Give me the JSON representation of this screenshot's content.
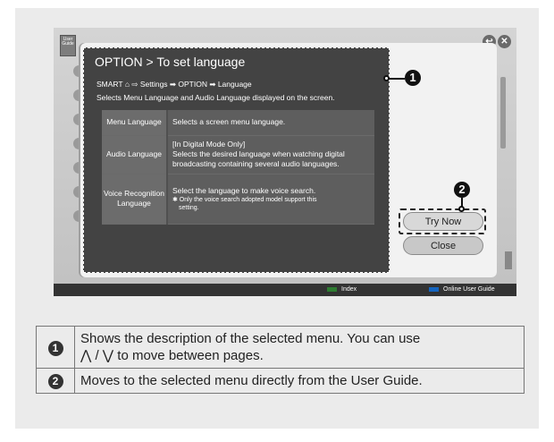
{
  "screen": {
    "guide_logo": "User Guide",
    "top_icons": [
      "back-icon",
      "close-icon"
    ],
    "title": "OPTION > To set language",
    "path": {
      "start": "SMART",
      "home_icon": "home-icon",
      "rest": "⇨ Settings ➡ OPTION ➡ Language"
    },
    "description": "Selects Menu Language and Audio Language displayed on the screen.",
    "rows": [
      {
        "key": "Menu Language",
        "value": "Selects a screen menu language."
      },
      {
        "key": "Audio Language",
        "value_lines": [
          "[In Digital Mode Only]",
          "Selects the desired language when watching digital",
          "broadcasting containing several audio languages."
        ]
      },
      {
        "key": "Voice Recognition Language",
        "value": "Select the language to make voice search.",
        "note_lines": [
          "✱ Only the voice search adopted model support this",
          "setting."
        ]
      }
    ],
    "buttons": {
      "try_now": "Try Now",
      "close": "Close"
    },
    "bottom_bar": {
      "index": "Index",
      "online_guide": "Online User Guide",
      "index_color": "#2e7d32",
      "online_guide_color": "#1565c0"
    }
  },
  "callouts": [
    "1",
    "2"
  ],
  "legend": [
    {
      "num": "1",
      "line1": "Shows the description of the selected menu. You can use",
      "line2": "to move between pages."
    },
    {
      "num": "2",
      "text": "Moves to the selected menu directly from the User Guide."
    }
  ],
  "page_up_down_symbol": "⋀ / ⋁"
}
